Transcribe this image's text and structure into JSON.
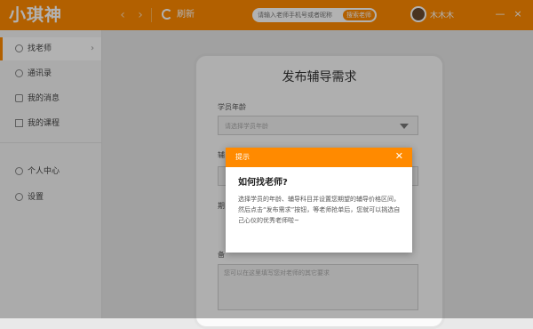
{
  "app": {
    "logo": "小琪神"
  },
  "toolbar": {
    "back_icon": "chevron-left-icon",
    "forward_icon": "chevron-right-icon",
    "refresh_label": "刷新",
    "search_placeholder": "请输入老师手机号或者昵称",
    "search_button": "搜索老师",
    "username": "木木木",
    "window_controls": [
      "—",
      "×"
    ]
  },
  "sidebar": {
    "items": [
      {
        "label": "找老师",
        "icon": "search-icon",
        "active": true
      },
      {
        "label": "通讯录",
        "icon": "contacts-icon"
      },
      {
        "label": "我的消息",
        "icon": "message-icon"
      },
      {
        "label": "我的课程",
        "icon": "course-icon"
      },
      {
        "label": "个人中心",
        "icon": "user-icon"
      },
      {
        "label": "设置",
        "icon": "gear-icon"
      }
    ]
  },
  "form": {
    "title": "发布辅导需求",
    "student_age_label": "学员年龄",
    "student_age_placeholder": "请选择学员年龄",
    "subject_label": "辅",
    "period_label": "期",
    "notes_label": "备",
    "notes_placeholder": "您可以在这里填写您对老师的其它要求"
  },
  "modal": {
    "header": "提示",
    "question": "如何找老师?",
    "body": "选择学员的年龄、辅导科目并设置您期望的辅导价格区间，然后点击“发布需求”按钮，等老师抢单后，您就可以挑选自己心仪的优秀老师啦~"
  },
  "colors": {
    "accent": "#ff8a00"
  }
}
